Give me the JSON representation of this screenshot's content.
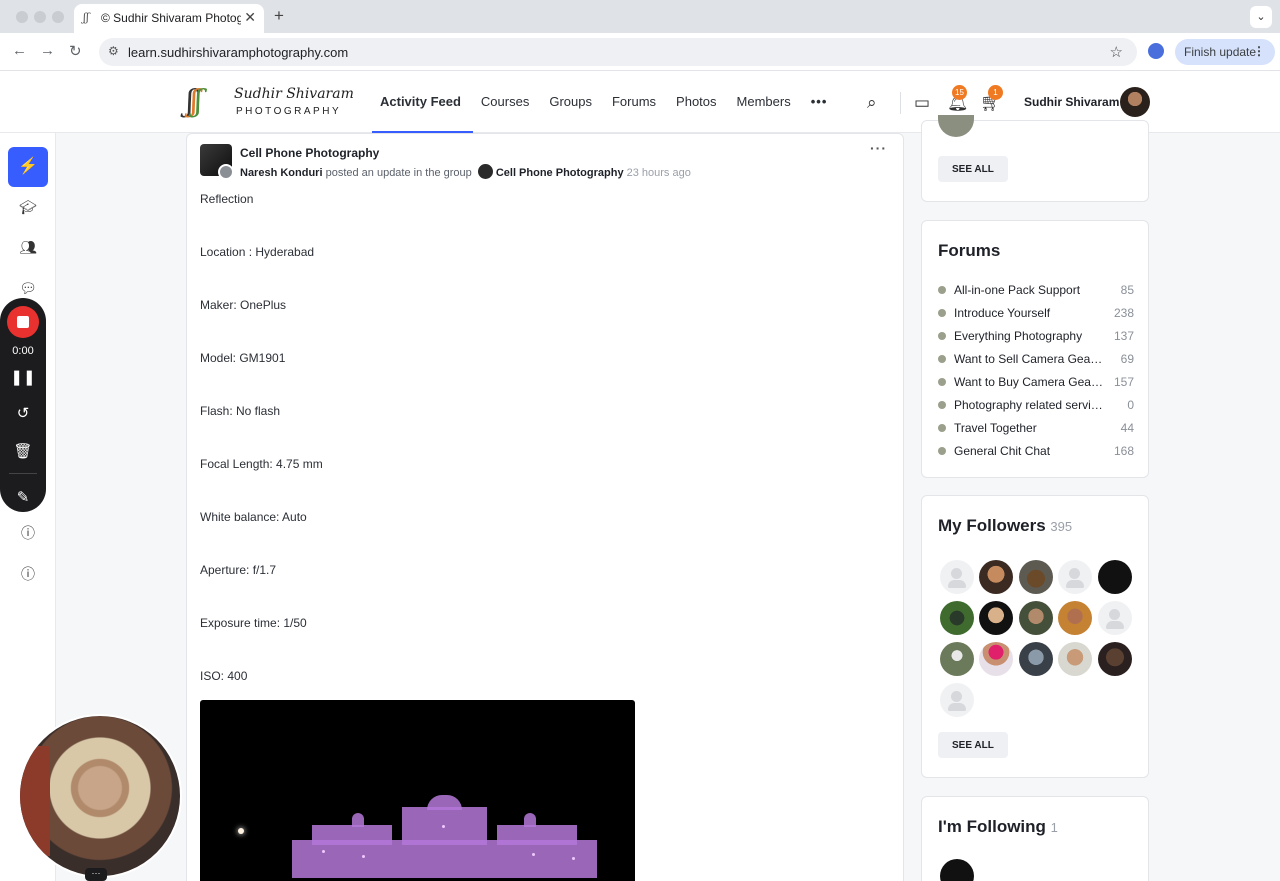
{
  "browser": {
    "tab_title": "© Sudhir Shivaram Photography",
    "url": "learn.sudhirshivaramphotography.com",
    "finish_update": "Finish update",
    "new_tab": "+",
    "close": "✕"
  },
  "site": {
    "logo_name": "Sudhir Shivaram",
    "logo_sub": "PHOTOGRAPHY",
    "nav": [
      "Activity Feed",
      "Courses",
      "Groups",
      "Forums",
      "Photos",
      "Members"
    ],
    "nav_more": "•••",
    "active_nav": "Activity Feed",
    "notifications_count": "15",
    "cart_count": "1",
    "user_name": "Sudhir Shivaram"
  },
  "recorder": {
    "time": "0:00"
  },
  "post": {
    "group_title": "Cell Phone Photography",
    "author": "Naresh Konduri",
    "action": "posted an update in the group",
    "group_link": "Cell Phone Photography",
    "time_ago": "23 hours ago",
    "lines": [
      "Reflection",
      "Location : Hyderabad",
      "Maker: OnePlus",
      "Model: GM1901",
      "Flash: No flash",
      "Focal Length: 4.75 mm",
      "White balance: Auto",
      "Aperture: f/1.7",
      "Exposure time: 1/50",
      "ISO: 400"
    ]
  },
  "sidebar": {
    "see_all": "SEE ALL",
    "forums": {
      "title": "Forums",
      "items": [
        {
          "name": "All-in-one Pack Support",
          "count": "85"
        },
        {
          "name": "Introduce Yourself",
          "count": "238"
        },
        {
          "name": "Everything Photography",
          "count": "137"
        },
        {
          "name": "Want to Sell Camera Gear ...",
          "count": "69"
        },
        {
          "name": "Want to Buy Camera Gear...",
          "count": "157"
        },
        {
          "name": "Photography related services",
          "count": "0"
        },
        {
          "name": "Travel Together",
          "count": "44"
        },
        {
          "name": "General Chit Chat",
          "count": "168"
        }
      ]
    },
    "followers": {
      "title": "My Followers",
      "count": "395"
    },
    "following": {
      "title": "I'm Following",
      "count": "1"
    }
  },
  "colors": {
    "accent": "#385dff",
    "record": "#e9322f",
    "badge": "#ef7a22"
  }
}
